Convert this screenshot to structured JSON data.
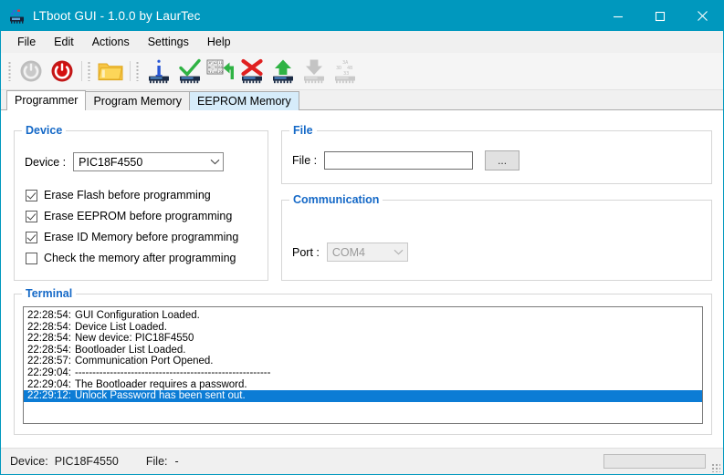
{
  "window": {
    "title": "LTboot GUI - 1.0.0   by LaurTec",
    "icon": "chip-icon",
    "accent_color": "#0098be",
    "controls": [
      {
        "name": "minimize-button",
        "glyph": "minimize-icon"
      },
      {
        "name": "maximize-button",
        "glyph": "maximize-icon"
      },
      {
        "name": "close-button",
        "glyph": "close-icon"
      }
    ]
  },
  "menubar": {
    "items": [
      {
        "label": "File"
      },
      {
        "label": "Edit"
      },
      {
        "label": "Actions"
      },
      {
        "label": "Settings"
      },
      {
        "label": "Help"
      }
    ]
  },
  "toolbar": {
    "groups": [
      {
        "buttons": [
          {
            "name": "disconnect-button",
            "icon": "power-off-icon",
            "enabled": false
          },
          {
            "name": "connect-button",
            "icon": "power-on-icon",
            "enabled": true
          }
        ]
      },
      {
        "buttons": [
          {
            "name": "open-file-button",
            "icon": "folder-icon",
            "enabled": true
          }
        ]
      },
      {
        "buttons": [
          {
            "name": "device-info-button",
            "icon": "chip-info-icon",
            "enabled": true
          },
          {
            "name": "verify-device-button",
            "icon": "chip-check-icon",
            "enabled": true
          },
          {
            "name": "read-memory-button",
            "icon": "memory-read-icon",
            "enabled": true
          },
          {
            "name": "erase-device-button",
            "icon": "chip-erase-icon",
            "enabled": true
          },
          {
            "name": "write-device-button",
            "icon": "chip-write-icon",
            "enabled": true
          },
          {
            "name": "read-device-button",
            "icon": "chip-read-icon",
            "enabled": false
          },
          {
            "name": "read-id-button",
            "icon": "chip-id-icon",
            "enabled": false
          }
        ]
      }
    ]
  },
  "tabs": [
    {
      "label": "Programmer",
      "state": "active"
    },
    {
      "label": "Program Memory",
      "state": "normal"
    },
    {
      "label": "EEPROM Memory",
      "state": "hover"
    }
  ],
  "device_group": {
    "title": "Device",
    "device_label": "Device :",
    "device_value": "PIC18F4550",
    "checkboxes": [
      {
        "label": "Erase Flash before programming",
        "checked": true
      },
      {
        "label": "Erase EEPROM before programming",
        "checked": true
      },
      {
        "label": "Erase ID Memory before programming",
        "checked": true
      },
      {
        "label": "Check the memory after programming",
        "checked": false
      }
    ]
  },
  "file_group": {
    "title": "File",
    "file_label": "File :",
    "file_value": "",
    "file_placeholder": "",
    "browse_label": "..."
  },
  "communication_group": {
    "title": "Communication",
    "port_label": "Port :",
    "port_value": "COM4",
    "port_enabled": false
  },
  "terminal": {
    "title": "Terminal",
    "selection_color": "#0c7cd5",
    "lines": [
      {
        "time": "22:28:54:",
        "message": "GUI Configuration Loaded.",
        "selected": false
      },
      {
        "time": "22:28:54:",
        "message": "Device List Loaded.",
        "selected": false
      },
      {
        "time": "22:28:54:",
        "message": "New device: PIC18F4550",
        "selected": false
      },
      {
        "time": "22:28:54:",
        "message": "Bootloader List Loaded.",
        "selected": false
      },
      {
        "time": "22:28:57:",
        "message": "Communication Port Opened.",
        "selected": false
      },
      {
        "time": "22:29:04:",
        "message": "--------------------------------------------------------",
        "selected": false
      },
      {
        "time": "22:29:04:",
        "message": "The Bootloader requires a password.",
        "selected": false
      },
      {
        "time": "22:29:12:",
        "message": "Unlock Password has been sent out.",
        "selected": true
      }
    ]
  },
  "statusbar": {
    "device_label": "Device:",
    "device_value": "PIC18F4550",
    "file_label": "File:",
    "file_value": "-",
    "progress_percent": 0
  }
}
